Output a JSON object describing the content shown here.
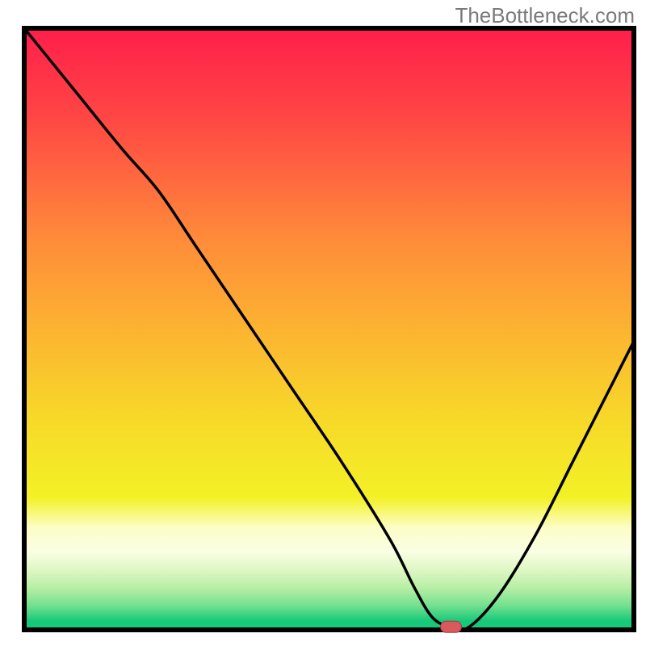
{
  "watermark": "TheBottleneck.com",
  "chart_data": {
    "type": "line",
    "title": "",
    "xlabel": "",
    "ylabel": "",
    "xlim": [
      0,
      100
    ],
    "ylim": [
      0,
      100
    ],
    "grid": false,
    "legend": false,
    "description": "Bottleneck curve over a vertical red-to-green gradient background. Y represents bottleneck percentage (higher = worse). The minimum (optimum) is marked by a red pill marker near x≈70.",
    "background_gradient_stops": [
      {
        "offset": 0.0,
        "color": "#ff1e4b"
      },
      {
        "offset": 0.15,
        "color": "#ff4744"
      },
      {
        "offset": 0.35,
        "color": "#ff8b3a"
      },
      {
        "offset": 0.5,
        "color": "#fcb331"
      },
      {
        "offset": 0.65,
        "color": "#f7d929"
      },
      {
        "offset": 0.78,
        "color": "#f3f126"
      },
      {
        "offset": 0.83,
        "color": "#fdfdc7"
      },
      {
        "offset": 0.87,
        "color": "#fafee3"
      },
      {
        "offset": 0.9,
        "color": "#dff7c4"
      },
      {
        "offset": 0.93,
        "color": "#b7efa6"
      },
      {
        "offset": 0.96,
        "color": "#72e08e"
      },
      {
        "offset": 0.985,
        "color": "#18c97a"
      },
      {
        "offset": 1.0,
        "color": "#18c97a"
      }
    ],
    "series": [
      {
        "name": "bottleneck-curve",
        "x": [
          0,
          8,
          16,
          22,
          28,
          36,
          44,
          52,
          60,
          64,
          67,
          70,
          73,
          78,
          84,
          90,
          96,
          100
        ],
        "y": [
          100,
          90,
          80,
          73,
          64,
          52,
          40,
          28,
          15,
          7,
          2,
          0.5,
          0.5,
          6,
          16,
          28,
          40,
          48
        ]
      }
    ],
    "optimum_marker": {
      "x": 70,
      "y": 0.5
    },
    "colors": {
      "curve": "#000000",
      "axis": "#000000",
      "marker_fill": "#d9595f",
      "marker_stroke": "#a03a40"
    }
  }
}
